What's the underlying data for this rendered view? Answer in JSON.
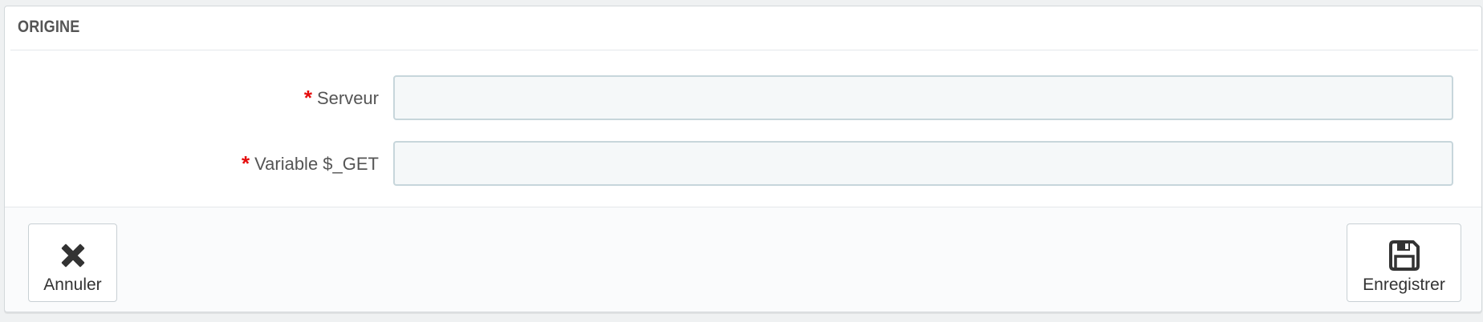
{
  "panel": {
    "title": "ORIGINE"
  },
  "form": {
    "fields": [
      {
        "required_mark": "*",
        "label": "Serveur",
        "value": ""
      },
      {
        "required_mark": "*",
        "label": "Variable $_GET",
        "value": ""
      }
    ]
  },
  "footer": {
    "cancel_label": "Annuler",
    "cancel_icon": "close-icon",
    "save_label": "Enregistrer",
    "save_icon": "floppy-disk-icon"
  },
  "colors": {
    "required": "#e50b0b",
    "input_background": "#f5f8f9",
    "input_border": "#c7d6db",
    "text": "#555555"
  }
}
